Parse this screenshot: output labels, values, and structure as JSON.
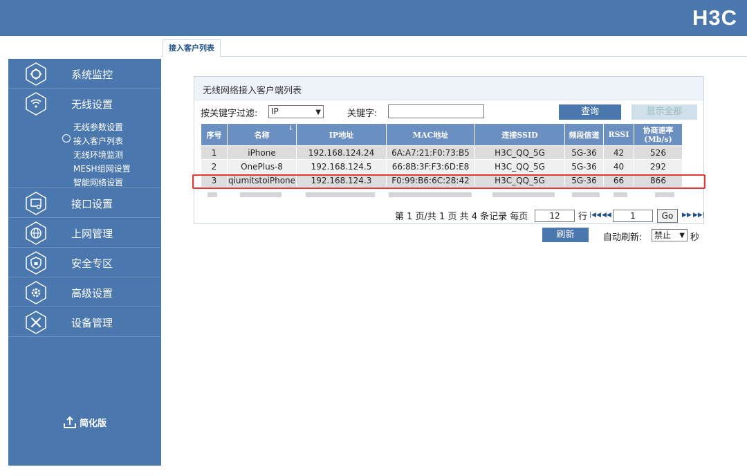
{
  "header": {
    "logo": "H3C"
  },
  "tabs": [
    {
      "label": "接入客户列表"
    }
  ],
  "sidebar": {
    "items": [
      {
        "label": "系统监控"
      },
      {
        "label": "无线设置"
      },
      {
        "label": "接口设置"
      },
      {
        "label": "上网管理"
      },
      {
        "label": "安全专区"
      },
      {
        "label": "高级设置"
      },
      {
        "label": "设备管理"
      }
    ],
    "subitems": [
      {
        "label": "无线参数设置"
      },
      {
        "label": "接入客户列表"
      },
      {
        "label": "无线环境监测"
      },
      {
        "label": "MESH组网设置"
      },
      {
        "label": "智能网络设置"
      }
    ],
    "simple_mode": "简化版"
  },
  "panel": {
    "title": "无线网络接入客户端列表",
    "filter_label": "按关键字过滤:",
    "filter_value": "IP",
    "keyword_label": "关键字:",
    "keyword_value": "",
    "query_button": "查询",
    "show_all_button": "显示全部"
  },
  "table": {
    "columns": [
      "序号",
      "名称",
      "IP地址",
      "MAC地址",
      "连接SSID",
      "频段信道",
      "RSSI",
      "协商速率(Mb/s)"
    ],
    "columns_line2": {
      "rate": "(Mb/s)"
    },
    "rate_line1": "协商速率",
    "rows": [
      [
        "1",
        "iPhone",
        "192.168.124.24",
        "6A:A7:21:F0:73:B5",
        "H3C_QQ_5G",
        "5G-36",
        "42",
        "526"
      ],
      [
        "2",
        "OnePlus-8",
        "192.168.124.5",
        "66:8B:3F:F3:6D:E8",
        "H3C_QQ_5G",
        "5G-36",
        "40",
        "292"
      ],
      [
        "3",
        "qiumitstoiPhone",
        "192.168.124.3",
        "F0:99:B6:6C:28:42",
        "H3C_QQ_5G",
        "5G-36",
        "66",
        "866"
      ]
    ]
  },
  "pager": {
    "summary": "第 1 页/共 1 页 共 4 条记录 每页",
    "per_page": "12",
    "rows_label": "行",
    "page_input": "1",
    "go_button": "Go"
  },
  "refresh": {
    "button": "刷新",
    "auto_label": "自动刷新:",
    "auto_value": "禁止",
    "unit": "秒"
  },
  "colors": {
    "brand": "#4a77ad",
    "header_cell": "#6b8fc0",
    "highlight": "#e53935"
  }
}
